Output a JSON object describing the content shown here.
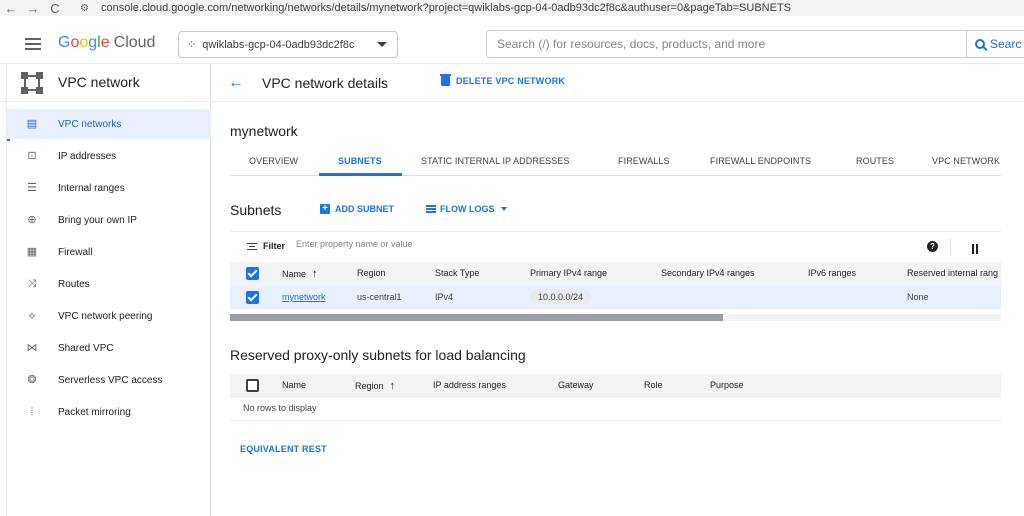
{
  "browser": {
    "back": "←",
    "forward": "→",
    "reload": "C",
    "url": "console.cloud.google.com/networking/networks/details/mynetwork?project=qwiklabs-gcp-04-0adb93dc2f8c&authuser=0&pageTab=SUBNETS"
  },
  "header": {
    "logo_letters": [
      "G",
      "o",
      "o",
      "g",
      "l",
      "e"
    ],
    "logo_cloud": "Cloud",
    "project": "qwiklabs-gcp-04-0adb93dc2f8c",
    "search_placeholder": "Search (/) for resources, docs, products, and more",
    "search_button": "Searc"
  },
  "sidebar": {
    "title": "VPC network",
    "items": [
      {
        "label": "VPC networks",
        "icon": "vpc-networks-icon",
        "glyph": "▤"
      },
      {
        "label": "IP addresses",
        "icon": "ip-addresses-icon",
        "glyph": "⊡"
      },
      {
        "label": "Internal ranges",
        "icon": "internal-ranges-icon",
        "glyph": "☰"
      },
      {
        "label": "Bring your own IP",
        "icon": "globe-icon",
        "glyph": "⊕"
      },
      {
        "label": "Firewall",
        "icon": "firewall-icon",
        "glyph": "▦"
      },
      {
        "label": "Routes",
        "icon": "routes-icon",
        "glyph": "⤨"
      },
      {
        "label": "VPC network peering",
        "icon": "peering-icon",
        "glyph": "⟡"
      },
      {
        "label": "Shared VPC",
        "icon": "shared-vpc-icon",
        "glyph": "⋈"
      },
      {
        "label": "Serverless VPC access",
        "icon": "serverless-icon",
        "glyph": "❂"
      },
      {
        "label": "Packet mirroring",
        "icon": "packet-mirroring-icon",
        "glyph": "⦙"
      }
    ]
  },
  "main": {
    "page_title": "VPC network details",
    "delete_label": "DELETE VPC NETWORK",
    "network_name": "mynetwork",
    "tabs": [
      "OVERVIEW",
      "SUBNETS",
      "STATIC INTERNAL IP ADDRESSES",
      "FIREWALLS",
      "FIREWALL ENDPOINTS",
      "ROUTES",
      "VPC NETWORK"
    ],
    "active_tab": "SUBNETS",
    "subnets": {
      "title": "Subnets",
      "add_label": "ADD SUBNET",
      "flow_logs_label": "FLOW LOGS",
      "filter_label": "Filter",
      "filter_placeholder": "Enter property name or value",
      "columns": [
        "Name",
        "Region",
        "Stack Type",
        "Primary IPv4 range",
        "Secondary IPv4 ranges",
        "IPv6 ranges",
        "Reserved internal rang"
      ],
      "rows": [
        {
          "name": "mynetwork",
          "region": "us-central1",
          "stack": "IPv4",
          "primary": "10.0.0.0/24",
          "secondary": "",
          "ipv6": "",
          "reserved": "None"
        }
      ]
    },
    "proxy": {
      "title": "Reserved proxy-only subnets for load balancing",
      "columns": [
        "Name",
        "Region",
        "IP address ranges",
        "Gateway",
        "Role",
        "Purpose"
      ],
      "empty": "No rows to display"
    },
    "equivalent_rest": "EQUIVALENT REST"
  }
}
